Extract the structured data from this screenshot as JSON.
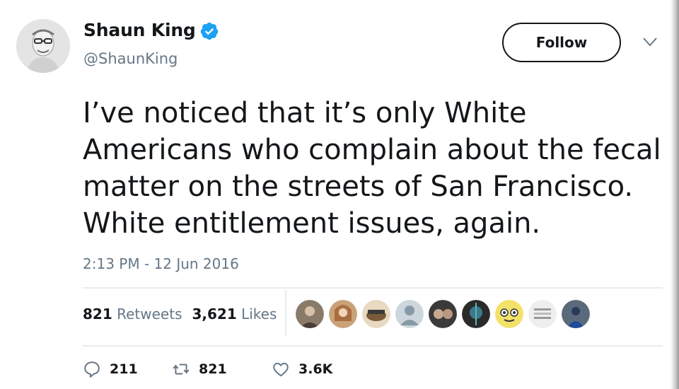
{
  "author": {
    "name": "Shaun King",
    "handle": "@ShaunKing",
    "verified": true,
    "verified_color": "#1da1f2"
  },
  "follow_button": {
    "label": "Follow"
  },
  "menu": {
    "icon": "chevron-down-icon"
  },
  "tweet": {
    "text_lines": [
      "I’ve noticed that it’s only White",
      "Americans who complain about the fecal",
      "matter on the streets of San Francisco.",
      "White entitlement issues, again."
    ],
    "timestamp": "2:13 PM - 12 Jun 2016"
  },
  "stats": {
    "retweets_count": "821",
    "retweets_label": "Retweets",
    "likes_count": "3,621",
    "likes_label": "Likes"
  },
  "likers": {
    "count_shown": 9
  },
  "actions": {
    "reply": {
      "count": "211",
      "icon": "reply-icon"
    },
    "retweet": {
      "count": "821",
      "icon": "retweet-icon"
    },
    "like": {
      "count": "3.6K",
      "icon": "heart-icon"
    }
  },
  "colors": {
    "text": "#14171a",
    "secondary": "#657786",
    "divider": "#e6ecf0",
    "verified": "#1da1f2"
  }
}
